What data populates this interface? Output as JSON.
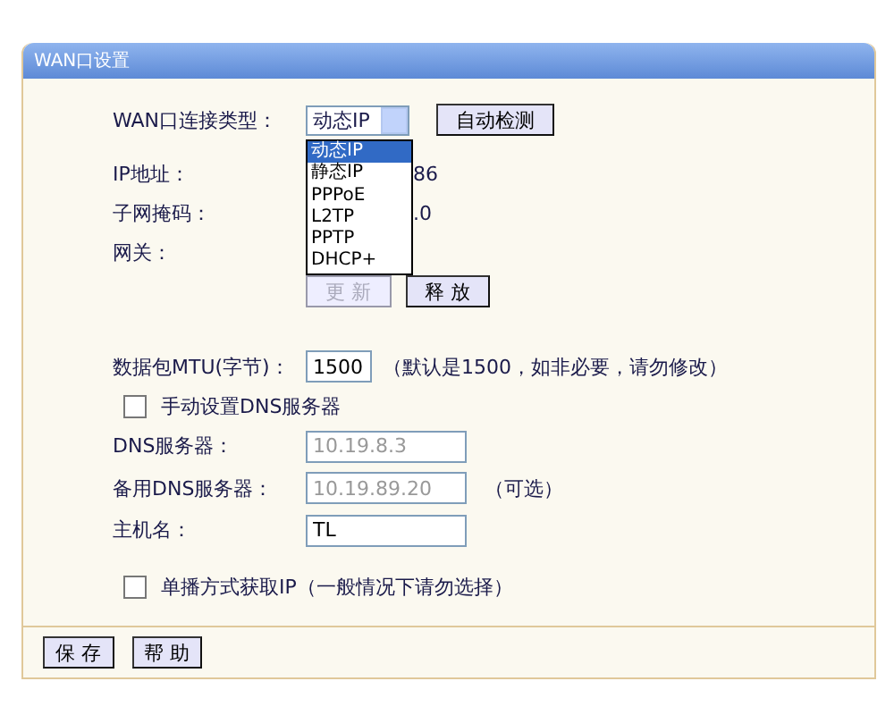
{
  "panel": {
    "title": "WAN口设置"
  },
  "connection_type": {
    "label": "WAN口连接类型：",
    "value": "动态IP",
    "detect_button": "自动检测",
    "dropdown": {
      "expanded": true,
      "options": [
        {
          "label": "动态IP",
          "selected": true
        },
        {
          "label": "静态IP",
          "selected": false
        },
        {
          "label": "PPPoE",
          "selected": false
        },
        {
          "label": "L2TP",
          "selected": false
        },
        {
          "label": "PPTP",
          "selected": false
        },
        {
          "label": "DHCP+",
          "selected": false
        }
      ]
    }
  },
  "info": [
    {
      "label": "IP地址：",
      "value": "86"
    },
    {
      "label": "子网掩码：",
      "value": ".0"
    },
    {
      "label": "网关："
    }
  ],
  "actions": [
    {
      "label": "更 新",
      "disabled": true
    },
    {
      "label": "释 放",
      "disabled": false
    }
  ],
  "mtu": {
    "label": "数据包MTU(字节)：",
    "value": "1500",
    "note": "（默认是1500，如非必要，请勿修改）"
  },
  "manual_dns": {
    "label": "手动设置DNS服务器",
    "checked": false
  },
  "fields": [
    {
      "label": "DNS服务器：",
      "value": "10.19.8.3",
      "disabled": true
    },
    {
      "label": "备用DNS服务器：",
      "value": "10.19.89.20",
      "disabled": true,
      "note": "（可选）"
    },
    {
      "label": "主机名：",
      "value": "TL",
      "disabled": false
    }
  ],
  "unicast": {
    "label": "单播方式获取IP（一般情况下请勿选择）",
    "checked": false
  },
  "footer_buttons": [
    "保 存",
    "帮 助"
  ]
}
